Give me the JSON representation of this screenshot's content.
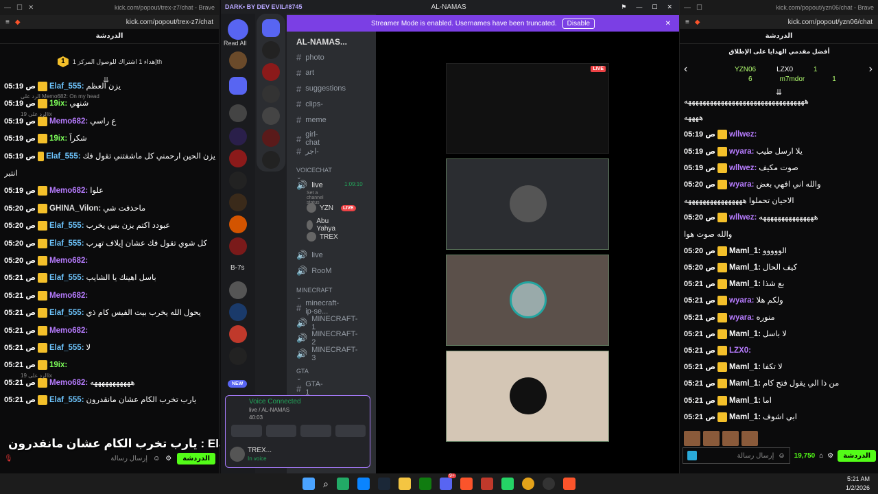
{
  "left": {
    "tab_title": "kick.com/popout/trex-z7/chat - Brave",
    "url": "kick.com/popout/trex-z7/chat",
    "chat_header": "الدردشة",
    "pinned": "إهداء 1 اشتراك للوصول المركز 1th",
    "pinned_rank": "1",
    "messages": [
      {
        "time": "05:19 ص",
        "user": "Elaf_555",
        "color": "#6ec6ff",
        "text": "يزن العظم"
      },
      {
        "time": "05:19 ص",
        "user": "19ix",
        "color": "#7dff5a",
        "text": "شنهي",
        "reply": "الرد على Memo682: On my head"
      },
      {
        "time": "05:19 ص",
        "user": "Memo682",
        "color": "#b77cff",
        "text": "ع راسي",
        "reply": "الرد على 19ix"
      },
      {
        "time": "05:19 ص",
        "user": "19ix",
        "color": "#7dff5a",
        "text": "شكراً"
      },
      {
        "time": "05:19 ص",
        "user": "Elaf_555",
        "color": "#6ec6ff",
        "text": "يزن الحين ارحمني كل ماشفتني تقول فك"
      },
      {
        "time": "",
        "user": "",
        "color": "#fff",
        "text": "انتبر"
      },
      {
        "time": "05:19 ص",
        "user": "Memo682",
        "color": "#b77cff",
        "text": "علوا"
      },
      {
        "time": "05:20 ص",
        "user": "GHINA_Vilon",
        "color": "#e0e0e0",
        "text": "ماحذفت شي"
      },
      {
        "time": "05:20 ص",
        "user": "Elaf_555",
        "color": "#6ec6ff",
        "text": "عبودد اكتم يزن بس يخرب"
      },
      {
        "time": "05:20 ص",
        "user": "Elaf_555",
        "color": "#6ec6ff",
        "text": "كل شوي تقول فك عشان إيلاف تهرب"
      },
      {
        "time": "05:20 ص",
        "user": "Memo682",
        "color": "#b77cff",
        "text": ""
      },
      {
        "time": "05:21 ص",
        "user": "Elaf_555",
        "color": "#6ec6ff",
        "text": "باسل اهينك يا الشايب"
      },
      {
        "time": "05:21 ص",
        "user": "Memo682",
        "color": "#b77cff",
        "text": ""
      },
      {
        "time": "05:21 ص",
        "user": "Elaf_555",
        "color": "#6ec6ff",
        "text": "يحول الله يخرب بيت الفيس كام ذي"
      },
      {
        "time": "05:21 ص",
        "user": "Memo682",
        "color": "#b77cff",
        "text": ""
      },
      {
        "time": "05:21 ص",
        "user": "Elaf_555",
        "color": "#6ec6ff",
        "text": "لا"
      },
      {
        "time": "05:21 ص",
        "user": "19ix",
        "color": "#7dff5a",
        "text": ""
      },
      {
        "time": "05:21 ص",
        "user": "Memo682",
        "color": "#b77cff",
        "text": "هههههههههههه",
        "reply": "الرد على 19ix"
      },
      {
        "time": "05:21 ص",
        "user": "Elaf_555",
        "color": "#6ec6ff",
        "text": "يارب تخرب الكام عشان مانقدرون"
      }
    ],
    "overlay_text": "يارب تخرب الكام عشان مانقدرون : Elaf_555",
    "input_placeholder": "إرسال رسالة",
    "send_label": "الدردشة"
  },
  "discord": {
    "title": "DARK• BY DEV EVIL#8745",
    "window_title": "AL-NAMAS",
    "read_all": "Read All",
    "banner": "Streamer Mode is enabled. Usernames have been truncated.",
    "disable": "Disable",
    "server_name": "AL-NAMAS...",
    "channels_top": [
      "photo",
      "art",
      "suggestions",
      "clips-",
      "meme",
      "girl-chat",
      "اجر-"
    ],
    "voicechat_header": "VOICECHAT",
    "live_channel": "live",
    "live_timer": "1:09:10",
    "live_status": "Set a channel status",
    "vc_users": [
      "YZN",
      "Abu Yahya",
      "TREX"
    ],
    "live_badge": "LIVE",
    "other_voice": [
      "live",
      "RooM"
    ],
    "minecraft_header": "MINECRAFT",
    "minecraft_channels": [
      "minecraft-ip-se...",
      "MINECRAFT-1",
      "MINECRAFT-2",
      "MINECRAFT-3"
    ],
    "gta_header": "GTA",
    "gta_channels": [
      "GTA-1"
    ],
    "voice_connected": "Voice Connected",
    "voice_path": "live / AL-NAMAS",
    "voice_time": "40:03",
    "self_name": "TREX...",
    "self_status": "In voice",
    "new_badge": "NEW",
    "b7s": "B-7s"
  },
  "right": {
    "tab_title": "kick.com/popout/yzn06/chat - Brave",
    "url": "kick.com/popout/yzn06/chat",
    "chat_header": "الدردشة",
    "top_gifters": "أفضل مقدمي الهدايا على الإطلاق",
    "gifters": [
      {
        "name": "YZN06",
        "count": "6"
      },
      {
        "name": "LZX0",
        "count": "1"
      },
      {
        "name": "m7mdor",
        "count": "1"
      }
    ],
    "messages": [
      {
        "time": "",
        "user": "",
        "color": "#fff",
        "text": "هههههههههههههههههههههههههههههههههه"
      },
      {
        "time": "",
        "user": "",
        "color": "#fff",
        "text": "ههههه"
      },
      {
        "time": "05:19 ص",
        "user": "wllwez",
        "color": "#b77cff",
        "text": ""
      },
      {
        "time": "05:19 ص",
        "user": "wyara",
        "color": "#b77cff",
        "text": "يلا ارسل طيب"
      },
      {
        "time": "05:19 ص",
        "user": "wllwez",
        "color": "#b77cff",
        "text": "صوت مكيف"
      },
      {
        "time": "05:20 ص",
        "user": "wyara",
        "color": "#b77cff",
        "text": "والله اني افهي بعض"
      },
      {
        "time": "",
        "user": "",
        "color": "#fff",
        "text": "الاحيان تحملوا ههههههههههههههههه"
      },
      {
        "time": "05:20 ص",
        "user": "wllwez",
        "color": "#b77cff",
        "text": "هههههههههههههههه"
      },
      {
        "time": "",
        "user": "",
        "color": "#fff",
        "text": "والله صوت هوا"
      },
      {
        "time": "05:20 ص",
        "user": "Maml_1",
        "color": "#fff",
        "text": "الووووو"
      },
      {
        "time": "05:20 ص",
        "user": "Maml_1",
        "color": "#fff",
        "text": "كيف الحال"
      },
      {
        "time": "05:21 ص",
        "user": "Maml_1",
        "color": "#fff",
        "text": "بع شذا"
      },
      {
        "time": "05:21 ص",
        "user": "wyara",
        "color": "#b77cff",
        "text": "ولكم هلا"
      },
      {
        "time": "05:21 ص",
        "user": "wyara",
        "color": "#b77cff",
        "text": "منوره"
      },
      {
        "time": "05:21 ص",
        "user": "Maml_1",
        "color": "#fff",
        "text": "لا باسل"
      },
      {
        "time": "05:21 ص",
        "user": "LZX0",
        "color": "#b77cff",
        "text": ""
      },
      {
        "time": "05:21 ص",
        "user": "Maml_1",
        "color": "#fff",
        "text": "لا تكفا"
      },
      {
        "time": "05:21 ص",
        "user": "Maml_1",
        "color": "#fff",
        "text": "من ذا الي يقول فتح كام"
      },
      {
        "time": "05:21 ص",
        "user": "Maml_1",
        "color": "#fff",
        "text": "اما"
      },
      {
        "time": "05:21 ص",
        "user": "Maml_1",
        "color": "#fff",
        "text": "ابي اشوف"
      }
    ],
    "input_placeholder": "إرسال رسالة",
    "points": "19,750",
    "send_label": "الدردشة"
  },
  "taskbar": {
    "time": "5:21 AM",
    "date": "1/2/2026",
    "discord_badge": "9+"
  }
}
